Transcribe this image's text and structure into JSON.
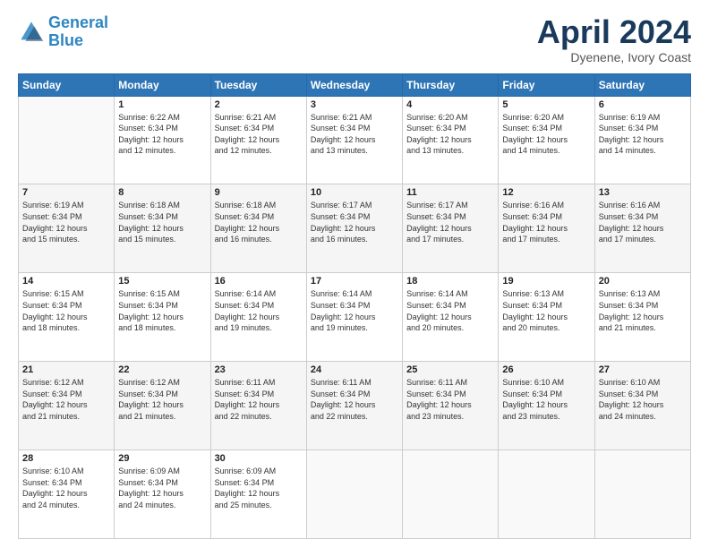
{
  "header": {
    "logo_line1": "General",
    "logo_line2": "Blue",
    "title": "April 2024",
    "subtitle": "Dyenene, Ivory Coast"
  },
  "columns": [
    "Sunday",
    "Monday",
    "Tuesday",
    "Wednesday",
    "Thursday",
    "Friday",
    "Saturday"
  ],
  "rows": [
    [
      {
        "day": "",
        "info": ""
      },
      {
        "day": "1",
        "info": "Sunrise: 6:22 AM\nSunset: 6:34 PM\nDaylight: 12 hours\nand 12 minutes."
      },
      {
        "day": "2",
        "info": "Sunrise: 6:21 AM\nSunset: 6:34 PM\nDaylight: 12 hours\nand 12 minutes."
      },
      {
        "day": "3",
        "info": "Sunrise: 6:21 AM\nSunset: 6:34 PM\nDaylight: 12 hours\nand 13 minutes."
      },
      {
        "day": "4",
        "info": "Sunrise: 6:20 AM\nSunset: 6:34 PM\nDaylight: 12 hours\nand 13 minutes."
      },
      {
        "day": "5",
        "info": "Sunrise: 6:20 AM\nSunset: 6:34 PM\nDaylight: 12 hours\nand 14 minutes."
      },
      {
        "day": "6",
        "info": "Sunrise: 6:19 AM\nSunset: 6:34 PM\nDaylight: 12 hours\nand 14 minutes."
      }
    ],
    [
      {
        "day": "7",
        "info": "Sunrise: 6:19 AM\nSunset: 6:34 PM\nDaylight: 12 hours\nand 15 minutes."
      },
      {
        "day": "8",
        "info": "Sunrise: 6:18 AM\nSunset: 6:34 PM\nDaylight: 12 hours\nand 15 minutes."
      },
      {
        "day": "9",
        "info": "Sunrise: 6:18 AM\nSunset: 6:34 PM\nDaylight: 12 hours\nand 16 minutes."
      },
      {
        "day": "10",
        "info": "Sunrise: 6:17 AM\nSunset: 6:34 PM\nDaylight: 12 hours\nand 16 minutes."
      },
      {
        "day": "11",
        "info": "Sunrise: 6:17 AM\nSunset: 6:34 PM\nDaylight: 12 hours\nand 17 minutes."
      },
      {
        "day": "12",
        "info": "Sunrise: 6:16 AM\nSunset: 6:34 PM\nDaylight: 12 hours\nand 17 minutes."
      },
      {
        "day": "13",
        "info": "Sunrise: 6:16 AM\nSunset: 6:34 PM\nDaylight: 12 hours\nand 17 minutes."
      }
    ],
    [
      {
        "day": "14",
        "info": "Sunrise: 6:15 AM\nSunset: 6:34 PM\nDaylight: 12 hours\nand 18 minutes."
      },
      {
        "day": "15",
        "info": "Sunrise: 6:15 AM\nSunset: 6:34 PM\nDaylight: 12 hours\nand 18 minutes."
      },
      {
        "day": "16",
        "info": "Sunrise: 6:14 AM\nSunset: 6:34 PM\nDaylight: 12 hours\nand 19 minutes."
      },
      {
        "day": "17",
        "info": "Sunrise: 6:14 AM\nSunset: 6:34 PM\nDaylight: 12 hours\nand 19 minutes."
      },
      {
        "day": "18",
        "info": "Sunrise: 6:14 AM\nSunset: 6:34 PM\nDaylight: 12 hours\nand 20 minutes."
      },
      {
        "day": "19",
        "info": "Sunrise: 6:13 AM\nSunset: 6:34 PM\nDaylight: 12 hours\nand 20 minutes."
      },
      {
        "day": "20",
        "info": "Sunrise: 6:13 AM\nSunset: 6:34 PM\nDaylight: 12 hours\nand 21 minutes."
      }
    ],
    [
      {
        "day": "21",
        "info": "Sunrise: 6:12 AM\nSunset: 6:34 PM\nDaylight: 12 hours\nand 21 minutes."
      },
      {
        "day": "22",
        "info": "Sunrise: 6:12 AM\nSunset: 6:34 PM\nDaylight: 12 hours\nand 21 minutes."
      },
      {
        "day": "23",
        "info": "Sunrise: 6:11 AM\nSunset: 6:34 PM\nDaylight: 12 hours\nand 22 minutes."
      },
      {
        "day": "24",
        "info": "Sunrise: 6:11 AM\nSunset: 6:34 PM\nDaylight: 12 hours\nand 22 minutes."
      },
      {
        "day": "25",
        "info": "Sunrise: 6:11 AM\nSunset: 6:34 PM\nDaylight: 12 hours\nand 23 minutes."
      },
      {
        "day": "26",
        "info": "Sunrise: 6:10 AM\nSunset: 6:34 PM\nDaylight: 12 hours\nand 23 minutes."
      },
      {
        "day": "27",
        "info": "Sunrise: 6:10 AM\nSunset: 6:34 PM\nDaylight: 12 hours\nand 24 minutes."
      }
    ],
    [
      {
        "day": "28",
        "info": "Sunrise: 6:10 AM\nSunset: 6:34 PM\nDaylight: 12 hours\nand 24 minutes."
      },
      {
        "day": "29",
        "info": "Sunrise: 6:09 AM\nSunset: 6:34 PM\nDaylight: 12 hours\nand 24 minutes."
      },
      {
        "day": "30",
        "info": "Sunrise: 6:09 AM\nSunset: 6:34 PM\nDaylight: 12 hours\nand 25 minutes."
      },
      {
        "day": "",
        "info": ""
      },
      {
        "day": "",
        "info": ""
      },
      {
        "day": "",
        "info": ""
      },
      {
        "day": "",
        "info": ""
      }
    ]
  ]
}
